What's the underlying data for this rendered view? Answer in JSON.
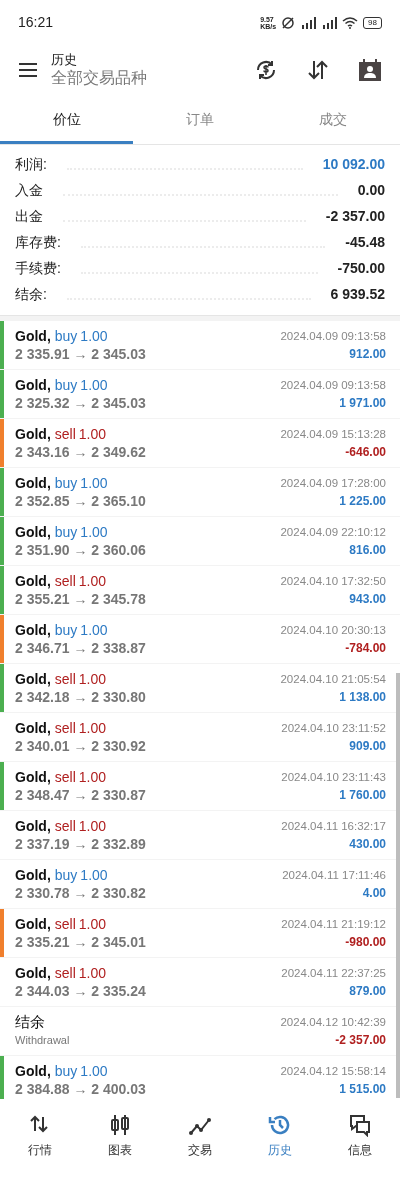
{
  "status_bar": {
    "time": "16:21",
    "net_speed": "9.57",
    "net_unit": "KB/s",
    "battery": "98"
  },
  "header": {
    "title": "历史",
    "subtitle": "全部交易品种"
  },
  "tabs": [
    {
      "label": "价位",
      "selected": true
    },
    {
      "label": "订单",
      "selected": false
    },
    {
      "label": "成交",
      "selected": false
    }
  ],
  "summary": [
    {
      "label": "利润:",
      "value": "10 092.00",
      "kind": "highlight"
    },
    {
      "label": "入金",
      "value": "0.00",
      "kind": "plain"
    },
    {
      "label": "出金",
      "value": "-2 357.00",
      "kind": "plain"
    },
    {
      "label": "库存费:",
      "value": "-45.48",
      "kind": "plain"
    },
    {
      "label": "手续费:",
      "value": "-750.00",
      "kind": "plain"
    },
    {
      "label": "结余:",
      "value": "6 939.52",
      "kind": "plain"
    }
  ],
  "deals": [
    {
      "kind": "trade",
      "symbol": "Gold,",
      "side": "buy",
      "volume": "1.00",
      "prices": "2 335.91 → 2 345.03",
      "time": "2024.04.09 09:13:58",
      "profit": "912.00",
      "color": "#4caf50"
    },
    {
      "kind": "trade",
      "symbol": "Gold,",
      "side": "buy",
      "volume": "1.00",
      "prices": "2 325.32 → 2 345.03",
      "time": "2024.04.09 09:13:58",
      "profit": "1 971.00",
      "color": "#4caf50"
    },
    {
      "kind": "trade",
      "symbol": "Gold,",
      "side": "sell",
      "volume": "1.00",
      "prices": "2 343.16 → 2 349.62",
      "time": "2024.04.09 15:13:28",
      "profit": "-646.00",
      "color": "#f07f2d"
    },
    {
      "kind": "trade",
      "symbol": "Gold,",
      "side": "buy",
      "volume": "1.00",
      "prices": "2 352.85 → 2 365.10",
      "time": "2024.04.09 17:28:00",
      "profit": "1 225.00",
      "color": "#4caf50"
    },
    {
      "kind": "trade",
      "symbol": "Gold,",
      "side": "buy",
      "volume": "1.00",
      "prices": "2 351.90 → 2 360.06",
      "time": "2024.04.09 22:10:12",
      "profit": "816.00",
      "color": "#4caf50"
    },
    {
      "kind": "trade",
      "symbol": "Gold,",
      "side": "sell",
      "volume": "1.00",
      "prices": "2 355.21 → 2 345.78",
      "time": "2024.04.10 17:32:50",
      "profit": "943.00",
      "color": "#4caf50"
    },
    {
      "kind": "trade",
      "symbol": "Gold,",
      "side": "buy",
      "volume": "1.00",
      "prices": "2 346.71 → 2 338.87",
      "time": "2024.04.10 20:30:13",
      "profit": "-784.00",
      "color": "#f07f2d"
    },
    {
      "kind": "trade",
      "symbol": "Gold,",
      "side": "sell",
      "volume": "1.00",
      "prices": "2 342.18 → 2 330.80",
      "time": "2024.04.10 21:05:54",
      "profit": "1 138.00",
      "color": "#4caf50"
    },
    {
      "kind": "trade",
      "symbol": "Gold,",
      "side": "sell",
      "volume": "1.00",
      "prices": "2 340.01 → 2 330.92",
      "time": "2024.04.10 23:11:52",
      "profit": "909.00"
    },
    {
      "kind": "trade",
      "symbol": "Gold,",
      "side": "sell",
      "volume": "1.00",
      "prices": "2 348.47 → 2 330.87",
      "time": "2024.04.10 23:11:43",
      "profit": "1 760.00",
      "color": "#4caf50"
    },
    {
      "kind": "trade",
      "symbol": "Gold,",
      "side": "sell",
      "volume": "1.00",
      "prices": "2 337.19 → 2 332.89",
      "time": "2024.04.11 16:32:17",
      "profit": "430.00"
    },
    {
      "kind": "trade",
      "symbol": "Gold,",
      "side": "buy",
      "volume": "1.00",
      "prices": "2 330.78 → 2 330.82",
      "time": "2024.04.11 17:11:46",
      "profit": "4.00"
    },
    {
      "kind": "trade",
      "symbol": "Gold,",
      "side": "sell",
      "volume": "1.00",
      "prices": "2 335.21 → 2 345.01",
      "time": "2024.04.11 21:19:12",
      "profit": "-980.00",
      "color": "#f07f2d"
    },
    {
      "kind": "trade",
      "symbol": "Gold,",
      "side": "sell",
      "volume": "1.00",
      "prices": "2 344.03 → 2 335.24",
      "time": "2024.04.11 22:37:25",
      "profit": "879.00"
    },
    {
      "kind": "balance",
      "title": "结余",
      "note": "Withdrawal",
      "time": "2024.04.12 10:42:39",
      "profit": "-2 357.00"
    },
    {
      "kind": "trade",
      "symbol": "Gold,",
      "side": "buy",
      "volume": "1.00",
      "prices": "2 384.88 → 2 400.03",
      "time": "2024.04.12 15:58:14",
      "profit": "1 515.00",
      "color": "#4caf50"
    }
  ],
  "bottom_nav": [
    {
      "label": "行情",
      "selected": false
    },
    {
      "label": "图表",
      "selected": false
    },
    {
      "label": "交易",
      "selected": false
    },
    {
      "label": "历史",
      "selected": true
    },
    {
      "label": "信息",
      "selected": false
    }
  ]
}
